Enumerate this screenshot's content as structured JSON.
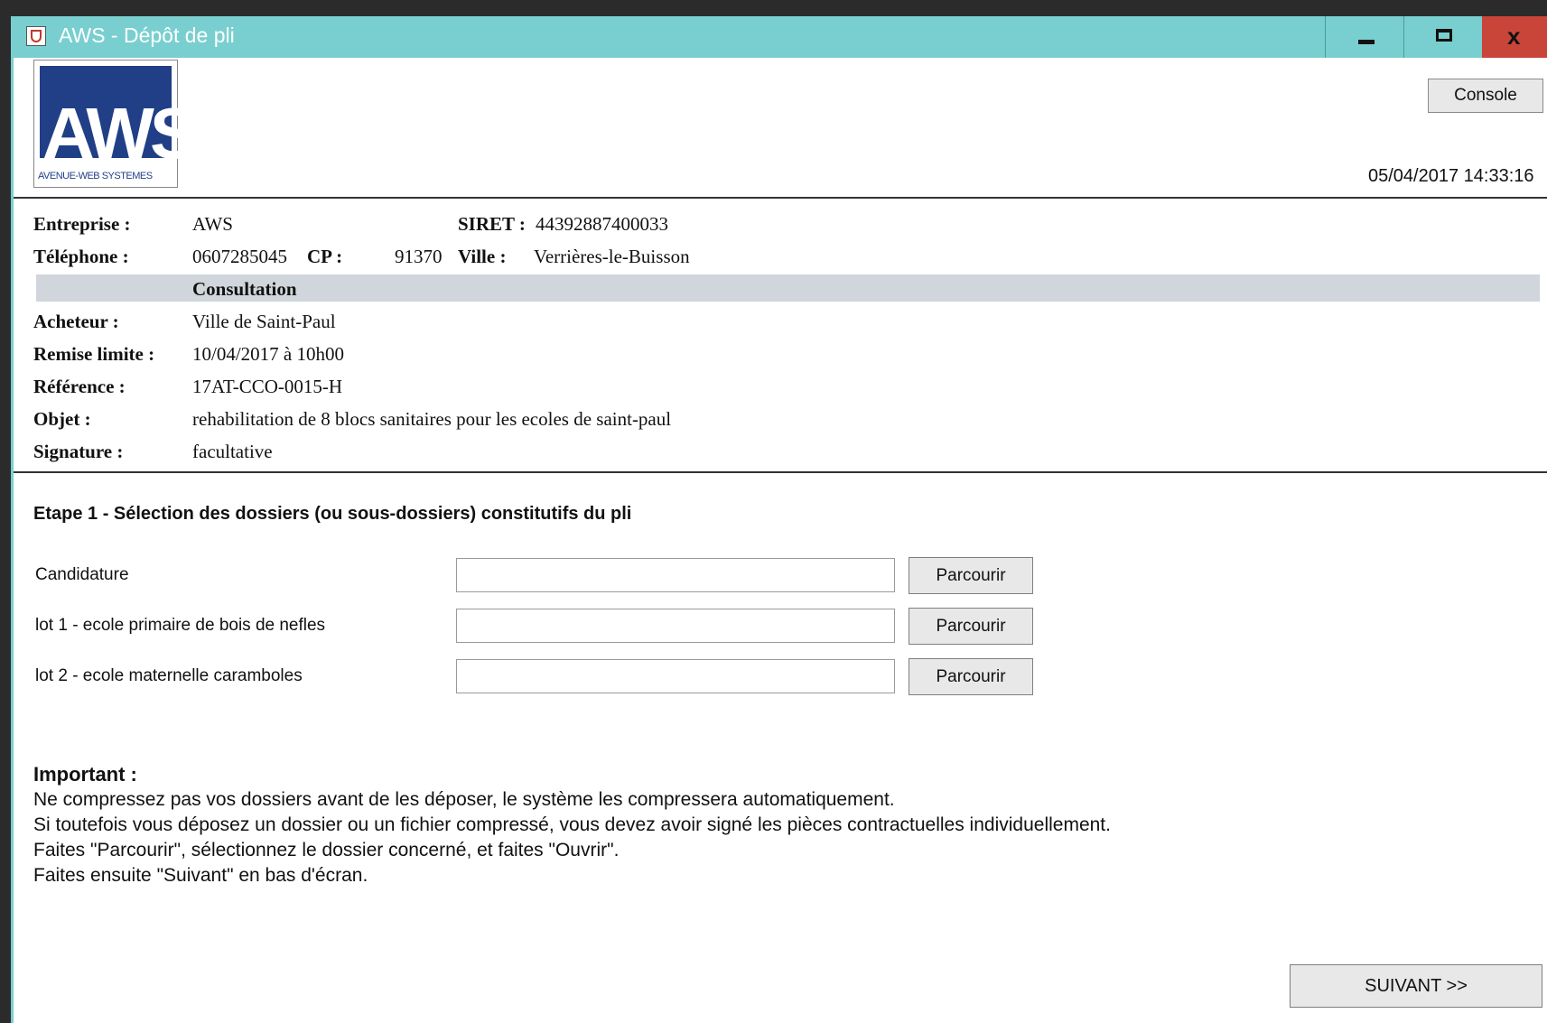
{
  "window": {
    "title": "AWS - Dépôt de pli",
    "minimize_label": "",
    "maximize_label": "",
    "close_label": "x"
  },
  "header": {
    "logo_text": "AWS",
    "logo_subtext": "AVENUE-WEB SYSTEMES",
    "console_label": "Console",
    "datetime": "05/04/2017 14:33:16"
  },
  "company": {
    "entreprise_label": "Entreprise :",
    "entreprise_value": "AWS",
    "siret_label": "SIRET :",
    "siret_value": "44392887400033",
    "telephone_label": "Téléphone :",
    "telephone_value": "0607285045",
    "cp_label": "CP :",
    "cp_value": "91370",
    "ville_label": "Ville :",
    "ville_value": "Verrières-le-Buisson"
  },
  "consultation": {
    "section_title": "Consultation",
    "acheteur_label": "Acheteur :",
    "acheteur_value": "Ville de Saint-Paul",
    "remise_label": "Remise limite :",
    "remise_value": "10/04/2017 à 10h00",
    "reference_label": "Référence :",
    "reference_value": "17AT-CCO-0015-H",
    "objet_label": "Objet :",
    "objet_value": "rehabilitation de 8 blocs sanitaires pour les ecoles de saint-paul",
    "signature_label": "Signature :",
    "signature_value": "facultative"
  },
  "step": {
    "title": "Etape 1 - Sélection des dossiers (ou sous-dossiers) constitutifs du pli",
    "rows": [
      {
        "label": "Candidature",
        "value": "",
        "button": "Parcourir"
      },
      {
        "label": "lot 1 - ecole primaire de bois de nefles",
        "value": "",
        "button": "Parcourir"
      },
      {
        "label": "lot 2 - ecole maternelle caramboles",
        "value": "",
        "button": "Parcourir"
      }
    ]
  },
  "important": {
    "title": "Important :",
    "lines": [
      "Ne compressez pas vos dossiers avant de les déposer, le système les compressera automatiquement.",
      "Si toutefois vous déposez un dossier ou un fichier compressé, vous devez avoir signé les pièces contractuelles individuellement.",
      "Faites \"Parcourir\", sélectionnez le dossier concerné, et faites \"Ouvrir\".",
      "Faites ensuite \"Suivant\" en bas d'écran."
    ]
  },
  "footer": {
    "next_label": "SUIVANT >>"
  }
}
